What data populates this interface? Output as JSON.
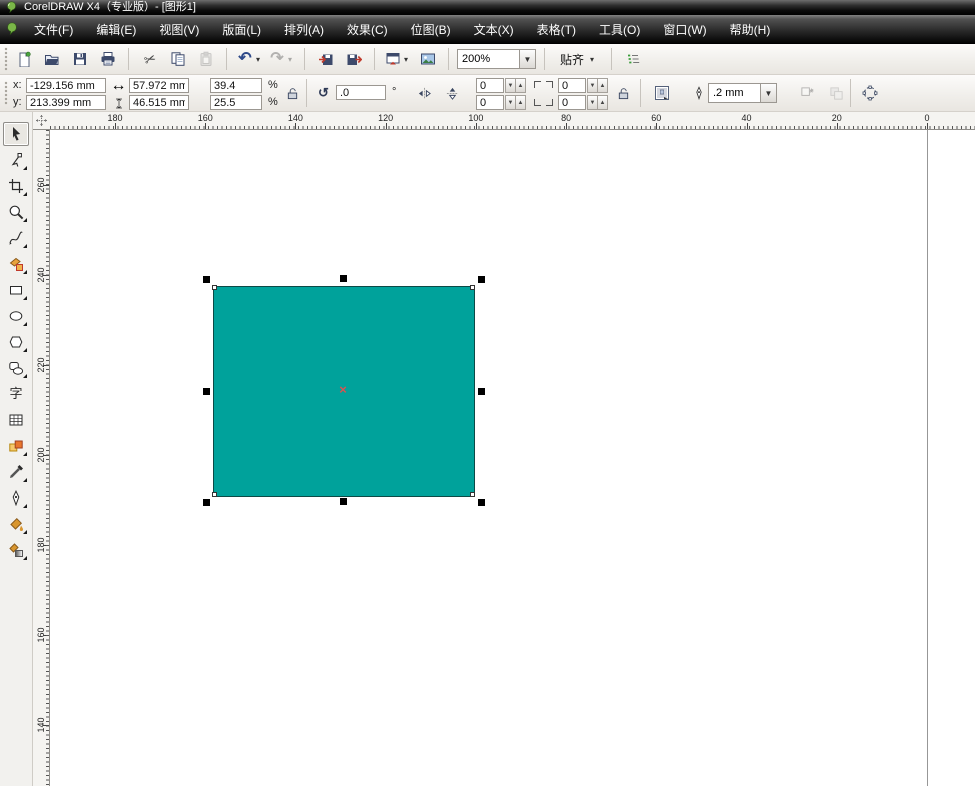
{
  "colors": {
    "shape_fill": "#00a29b",
    "shape_outline": "#0c4a46",
    "selection_handle": "#000000",
    "center_marker": "#d9534f"
  },
  "window": {
    "title": "CorelDRAW X4（专业版）- [图形1]",
    "app_icon": "coreldraw-balloon-icon"
  },
  "menu": {
    "items": [
      "文件(F)",
      "编辑(E)",
      "视图(V)",
      "版面(L)",
      "排列(A)",
      "效果(C)",
      "位图(B)",
      "文本(X)",
      "表格(T)",
      "工具(O)",
      "窗口(W)",
      "帮助(H)"
    ]
  },
  "toolbar": {
    "zoom_level": "200%",
    "snap_label": "贴齐",
    "buttons": [
      {
        "icon": "new-document-icon"
      },
      {
        "icon": "open-icon"
      },
      {
        "icon": "save-icon"
      },
      {
        "icon": "print-icon"
      },
      {
        "sep": true
      },
      {
        "icon": "cut-icon"
      },
      {
        "icon": "copy-icon"
      },
      {
        "icon": "paste-icon",
        "disabled": true
      },
      {
        "sep": true
      },
      {
        "icon": "undo-icon",
        "dropdown": true
      },
      {
        "icon": "redo-icon",
        "disabled": true,
        "dropdown": true
      },
      {
        "sep": true
      },
      {
        "icon": "import-icon"
      },
      {
        "icon": "export-icon"
      },
      {
        "sep": true
      },
      {
        "icon": "app-launcher-icon",
        "dropdown": true
      },
      {
        "icon": "welcome-screen-icon"
      },
      {
        "sep": true
      },
      {
        "zoom_combo": true
      },
      {
        "sep": true
      },
      {
        "snap": true
      },
      {
        "sep": true
      },
      {
        "icon": "options-icon"
      }
    ]
  },
  "property_bar": {
    "x_label": "x:",
    "x_value": "-129.156 mm",
    "y_label": "y:",
    "y_value": "213.399 mm",
    "width_value": "57.972 mm",
    "height_value": "46.515 mm",
    "scale_h_value": "39.4",
    "scale_v_value": "25.5",
    "percent": "%",
    "rotation_value": ".0",
    "degree": "°",
    "corner_tl": "0",
    "corner_tr": "0",
    "corner_bl": "0",
    "corner_br": "0",
    "outline_width": ".2 mm"
  },
  "toolbox": {
    "tools": [
      {
        "name": "pick-tool",
        "icon": "pick-tool-icon",
        "active": true
      },
      {
        "name": "shape-tool",
        "icon": "shape-tool-icon",
        "flyout": true
      },
      {
        "name": "crop-tool",
        "icon": "crop-tool-icon",
        "flyout": true
      },
      {
        "name": "zoom-tool",
        "icon": "zoom-tool-icon",
        "flyout": true
      },
      {
        "name": "freehand-tool",
        "icon": "freehand-tool-icon",
        "flyout": true
      },
      {
        "name": "smart-fill-tool",
        "icon": "smart-fill-tool-icon",
        "flyout": true
      },
      {
        "name": "rectangle-tool",
        "icon": "rectangle-tool-icon",
        "flyout": true
      },
      {
        "name": "ellipse-tool",
        "icon": "ellipse-tool-icon",
        "flyout": true
      },
      {
        "name": "polygon-tool",
        "icon": "polygon-tool-icon",
        "flyout": true
      },
      {
        "name": "basic-shapes-tool",
        "icon": "basic-shapes-tool-icon",
        "flyout": true
      },
      {
        "name": "text-tool",
        "icon": "text-tool-icon"
      },
      {
        "name": "table-tool",
        "icon": "table-tool-icon"
      },
      {
        "name": "interactive-blend-tool",
        "icon": "blend-tool-icon",
        "flyout": true
      },
      {
        "name": "eyedropper-tool",
        "icon": "eyedropper-tool-icon",
        "flyout": true
      },
      {
        "name": "outline-pen-tool",
        "icon": "outline-pen-tool-icon",
        "flyout": true
      },
      {
        "name": "fill-tool",
        "icon": "fill-tool-icon",
        "flyout": true
      },
      {
        "name": "interactive-fill-tool",
        "icon": "interactive-fill-tool-icon",
        "flyout": true
      }
    ]
  },
  "rulers": {
    "horizontal_labels": [
      "180",
      "160",
      "140",
      "120",
      "100",
      "80",
      "60",
      "40",
      "20",
      "0"
    ],
    "vertical_labels": [
      "260",
      "240",
      "220",
      "200",
      "180",
      "160",
      "140"
    ]
  },
  "canvas": {
    "selected_shape": {
      "type": "rectangle",
      "fill": "#00a29b",
      "center_marker_glyph": "×"
    }
  }
}
